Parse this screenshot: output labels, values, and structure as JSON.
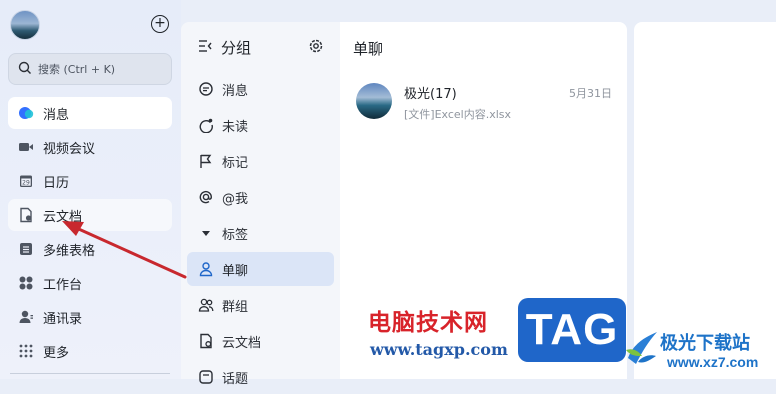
{
  "sidebar": {
    "search_placeholder": "搜索 (Ctrl + K)",
    "items": [
      {
        "label": "消息",
        "icon": "chat-bubble-icon"
      },
      {
        "label": "视频会议",
        "icon": "video-camera-icon"
      },
      {
        "label": "日历",
        "icon": "calendar-icon",
        "icon_text": "29"
      },
      {
        "label": "云文档",
        "icon": "cloud-doc-icon"
      },
      {
        "label": "多维表格",
        "icon": "table-grid-icon"
      },
      {
        "label": "工作台",
        "icon": "apps-icon"
      },
      {
        "label": "通讯录",
        "icon": "contacts-icon"
      },
      {
        "label": "更多",
        "icon": "more-dots-icon"
      }
    ]
  },
  "groups": {
    "title": "分组",
    "items": [
      {
        "label": "消息",
        "icon": "message-icon"
      },
      {
        "label": "未读",
        "icon": "unread-icon"
      },
      {
        "label": "标记",
        "icon": "flag-icon"
      },
      {
        "label": "@我",
        "icon": "at-icon"
      },
      {
        "label": "标签",
        "icon": "caret-down-icon"
      },
      {
        "label": "单聊",
        "icon": "person-icon"
      },
      {
        "label": "群组",
        "icon": "group-icon"
      },
      {
        "label": "云文档",
        "icon": "doc-icon"
      },
      {
        "label": "话题",
        "icon": "topic-icon"
      }
    ]
  },
  "chat": {
    "title": "单聊",
    "conversations": [
      {
        "name": "极光(17)",
        "date": "5月31日",
        "preview": "[文件]Excel内容.xlsx"
      }
    ]
  },
  "watermark": {
    "site_name": "电脑技术网",
    "site_url": "www.tagxp.com",
    "badge": "TAG",
    "brand_name": "极光下载站",
    "brand_url": "www.xz7.com"
  },
  "colors": {
    "accent": "#1f66c9",
    "active_group_bg": "#dbe5f7",
    "annotation_arrow": "#c8282e",
    "watermark_red": "#d8232a"
  }
}
